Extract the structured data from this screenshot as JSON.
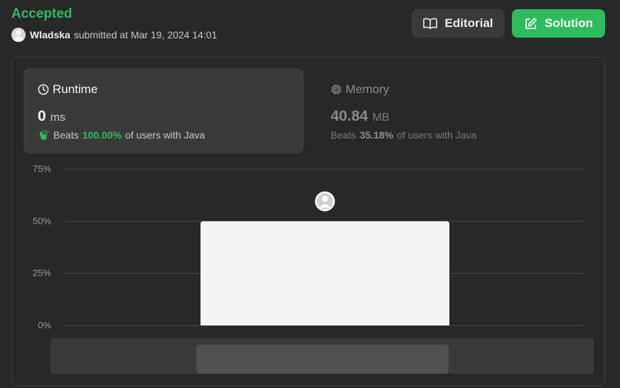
{
  "header": {
    "status": "Accepted",
    "user": "Wladska",
    "submitted_text": "submitted at Mar 19, 2024 14:01",
    "editorial_label": "Editorial",
    "solution_label": "Solution"
  },
  "runtime": {
    "title": "Runtime",
    "value": "0",
    "unit": "ms",
    "beats_label": "Beats",
    "beats_value": "100.00%",
    "beats_suffix": "of users with Java"
  },
  "memory": {
    "title": "Memory",
    "value": "40.84",
    "unit": "MB",
    "beats_label": "Beats",
    "beats_value": "35.18%",
    "beats_suffix": "of users with Java"
  },
  "colors": {
    "accent": "#2cbb5d",
    "bar": "#f5f5f5",
    "background": "#282828"
  },
  "chart_data": {
    "type": "bar",
    "categories": [
      ""
    ],
    "values": [
      50
    ],
    "ylim": [
      0,
      75
    ],
    "yticks": [
      "0%",
      "25%",
      "50%",
      "75%"
    ],
    "grid": true,
    "marker": "user-avatar"
  }
}
